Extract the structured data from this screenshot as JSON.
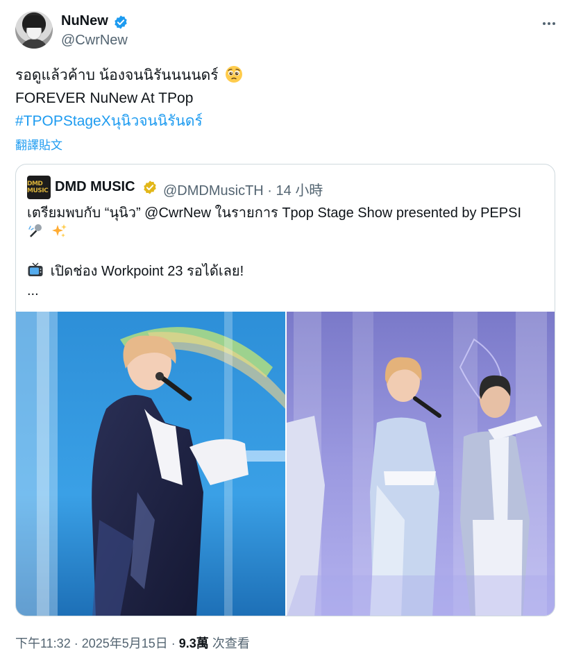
{
  "author": {
    "display_name": "NuNew",
    "handle": "@CwrNew"
  },
  "tweet": {
    "lines": [
      "รอดูแล้วค้าบ น้องจนนิรันนนนดร์",
      "FOREVER NuNew At TPop"
    ],
    "hashtag": "#TPOPStageXนุนิวจนนิรันดร์",
    "translate_label": "翻譯貼文"
  },
  "quote": {
    "display_name": "DMD MUSIC",
    "handle_time": "@DMDMusicTH · 14 小時",
    "avatar_text": "DMD MUSIC",
    "line1": "เตรียมพบกับ “นุนิว” @CwrNew ในรายการ Tpop Stage Show presented by PEPSI",
    "line3": "เปิดช่อง Workpoint 23 รอได้เลย!",
    "line4": "..."
  },
  "footer": {
    "time_date": "下午11:32 · 2025年5月15日 · ",
    "views_count": "9.3萬",
    "views_label": " 次查看"
  },
  "colors": {
    "accent": "#1d9bf0",
    "text": "#0f1419",
    "secondary": "#536471",
    "border": "#cfd9de",
    "gold_badge": "#e2b719"
  },
  "icons": {
    "verified": "blue-verified-badge",
    "quote_verified": "gold-verified-badge",
    "more": "more-horizontal-icon"
  }
}
